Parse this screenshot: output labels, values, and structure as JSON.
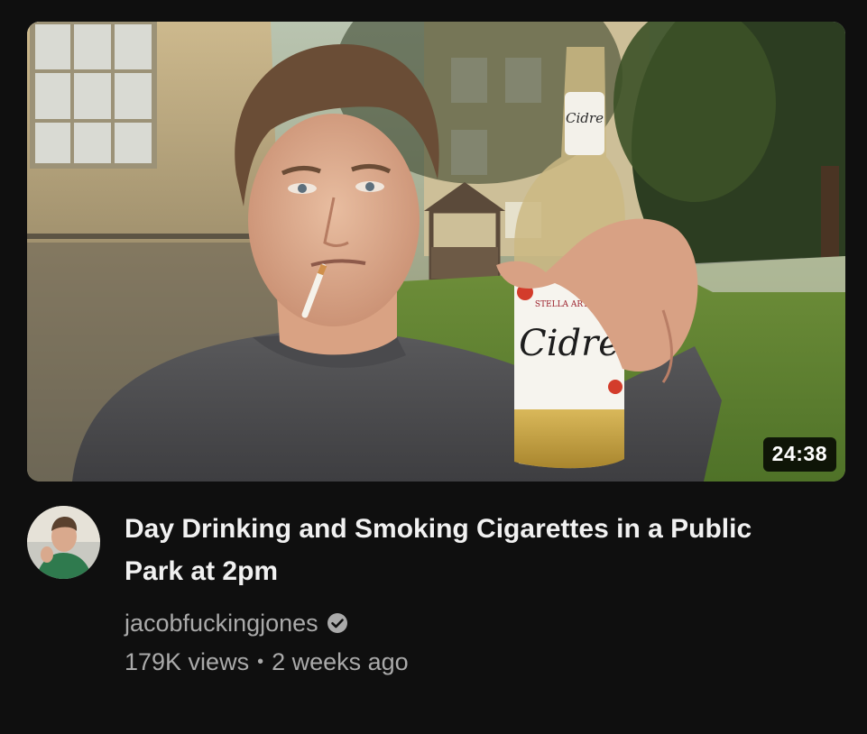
{
  "video": {
    "duration": "24:38",
    "title": "Day Drinking and Smoking Cigarettes in a Public Park at 2pm",
    "channel": "jacobfuckingjones",
    "views": "179K views",
    "separator": "•",
    "age": "2 weeks ago",
    "thumbnail_bottle_label": "Cidre",
    "thumbnail_bottle_brand": "STELLA ARTOIS"
  },
  "icons": {
    "verified": "verified-check-icon"
  },
  "colors": {
    "background": "#0f0f0f",
    "title": "#f1f1f1",
    "secondary_text": "#aaaaaa",
    "duration_badge": "#000000"
  }
}
